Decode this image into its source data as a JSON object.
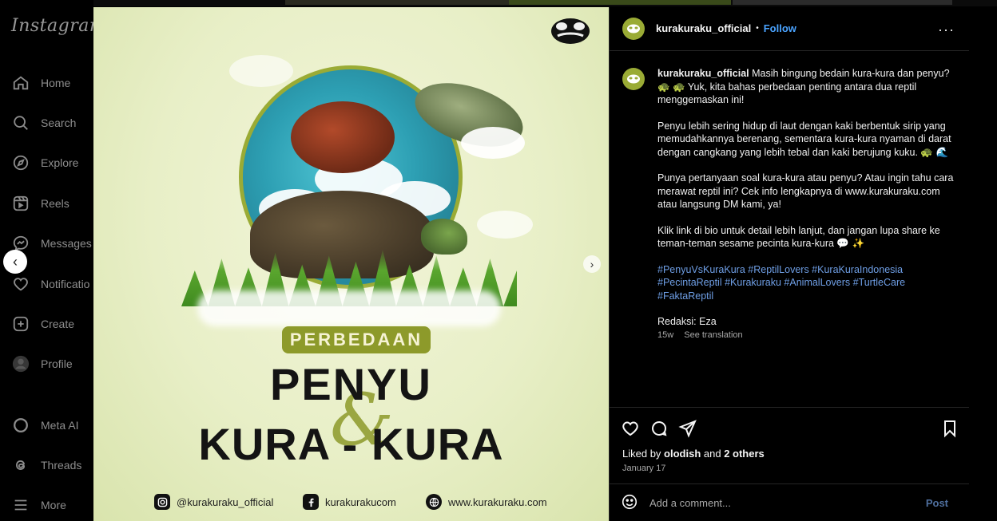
{
  "sidebar": {
    "logo": "Instagram",
    "items": [
      {
        "label": "Home",
        "icon": "home-icon"
      },
      {
        "label": "Search",
        "icon": "search-icon"
      },
      {
        "label": "Explore",
        "icon": "compass-icon"
      },
      {
        "label": "Reels",
        "icon": "reels-icon"
      },
      {
        "label": "Messages",
        "icon": "messenger-icon"
      },
      {
        "label": "Notificatio",
        "icon": "heart-icon"
      },
      {
        "label": "Create",
        "icon": "plus-square-icon"
      },
      {
        "label": "Profile",
        "icon": "profile-avatar-icon"
      },
      {
        "label": "Meta AI",
        "icon": "meta-ai-icon"
      },
      {
        "label": "Threads",
        "icon": "threads-icon"
      },
      {
        "label": "More",
        "icon": "menu-icon"
      }
    ]
  },
  "post_image": {
    "pill_text": "PERBEDAAN",
    "title_line1": "PENYU",
    "ampersand": "&",
    "title_line2": "KURA - KURA",
    "social": {
      "instagram": "@kurakuraku_official",
      "facebook": "kurakurakucom",
      "website": "www.kurakuraku.com"
    }
  },
  "header": {
    "username": "kurakuraku_official",
    "separator": "•",
    "follow_label": "Follow",
    "more": "···"
  },
  "caption": {
    "username": "kurakuraku_official",
    "p1": "Masih bingung bedain kura-kura dan penyu? 🐢 🐢 Yuk, kita bahas perbedaan penting antara dua reptil menggemaskan ini!",
    "p2": "Penyu lebih sering hidup di laut dengan kaki berbentuk sirip yang memudahkannya berenang, sementara kura-kura nyaman di darat dengan cangkang yang lebih tebal dan kaki berujung kuku. 🐢 🌊",
    "p3": "Punya pertanyaan soal kura-kura atau penyu? Atau ingin tahu cara merawat reptil ini? Cek info lengkapnya di www.kurakuraku.com atau langsung DM kami, ya!",
    "p4": "Klik link di bio untuk detail lebih lanjut, dan jangan lupa share ke teman-teman sesame pecinta kura-kura 💬 ✨",
    "hashtags": "#PenyuVsKuraKura #ReptilLovers #KuraKuraIndonesia #PecintaReptil #Kurakuraku #AnimalLovers #TurtleCare #FaktaReptil",
    "credit": "Redaksi: Eza",
    "age": "15w",
    "see_translation": "See translation"
  },
  "actions": {
    "liked_prefix": "Liked by ",
    "liked_user": "olodish",
    "liked_mid": " and ",
    "liked_others": "2 others",
    "date": "January 17"
  },
  "comment": {
    "placeholder": "Add a comment...",
    "post_label": "Post"
  },
  "colors": {
    "accent_olive": "#8d9a2a",
    "link_blue": "#4aa3ff",
    "hashtag_blue": "#6f9fe6"
  }
}
